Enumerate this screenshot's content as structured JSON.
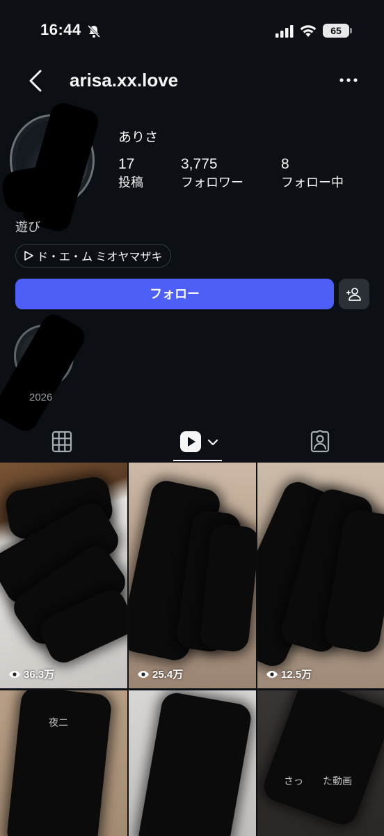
{
  "status_bar": {
    "time": "16:44",
    "battery": "65"
  },
  "header": {
    "username": "arisa.xx.love"
  },
  "profile": {
    "display_name": "ありさ",
    "bio": "遊び",
    "stats": [
      {
        "value": "17",
        "label": "投稿"
      },
      {
        "value": "3,775",
        "label": "フォロワー"
      },
      {
        "value": "8",
        "label": "フォロー中"
      }
    ],
    "music": "ド・エ・ム ミオヤマザキ"
  },
  "actions": {
    "follow_label": "フォロー"
  },
  "highlights": [
    {
      "label": "2026"
    }
  ],
  "tabs": {
    "active": "reels",
    "names": [
      "grid-icon",
      "reels-icon",
      "tagged-icon"
    ]
  },
  "grid": {
    "tiles": [
      {
        "views": "36.3万"
      },
      {
        "views": "25.4万"
      },
      {
        "views": "12.5万"
      },
      {
        "caption": "夜二"
      },
      {
        "caption": ""
      },
      {
        "caption": "さっ　　た動画"
      }
    ]
  },
  "colors": {
    "background": "#0c1014",
    "accent": "#4d5ff7",
    "secondary_button": "#2a3036"
  }
}
